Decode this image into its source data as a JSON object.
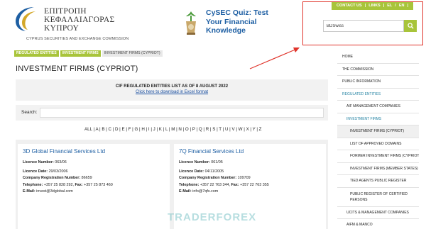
{
  "logo": {
    "lines": [
      "ΕΠΙΤΡΟΠΗ",
      "ΚΕΦΑΛΑΙΑΓΟΡΑΣ",
      "ΚΥΠΡΟΥ"
    ],
    "subtitle": "CYPRUS SECURITIES AND EXCHANGE COMMISSION"
  },
  "quiz": {
    "line1": "CySEC Quiz: Test",
    "line2": "Your Financial",
    "line3": "Knowledge"
  },
  "toplinks": [
    "CONTACT US",
    "|",
    "LINKS",
    "|",
    "EL",
    "/",
    "EN",
    "|"
  ],
  "search": {
    "value": "BDSwiss"
  },
  "breadcrumbs": [
    "REGULATED ENTITIES",
    "INVESTMENT FIRMS",
    "INVESTMENT FIRMS (CYPRIOT)"
  ],
  "page_title": "INVESTMENT FIRMS (CYPRIOT)",
  "panel": {
    "title": "CIF REGULATED ENTITIES LIST AS OF 8 AUGUST 2022",
    "link": "Click here to download in Excel format"
  },
  "search_row": {
    "label": "Search:"
  },
  "alphabet": "ALL | A | B | C | D | E | F | G | H | I | J | K | L | M | N | O | P | Q | R | S | T | U | V | W | X | Y | Z",
  "cards": [
    {
      "name": "3D Global Financial Services Ltd",
      "licence_number_label": "Licence Number:",
      "licence_number": "063/06",
      "licence_date_label": "Licence Date:",
      "licence_date": "29/03/2006",
      "reg_label": "Company Registration Number:",
      "reg": "86659",
      "tel_label": "Telephone:",
      "tel": "+357 25 828 292,",
      "fax_label": "Fax:",
      "fax": "+357 25 873 460",
      "email_label": "E-Mail:",
      "email": "invest@3dglobal.com"
    },
    {
      "name": "7Q Financial Services Ltd",
      "licence_number_label": "Licence Number:",
      "licence_number": "061/05",
      "licence_date_label": "Licence Date:",
      "licence_date": "04/11/2005",
      "reg_label": "Company Registration Number:",
      "reg": "109709",
      "tel_label": "Telephone:",
      "tel": "+357 22 763 344,",
      "fax_label": "Fax:",
      "fax": "+357 22 763 355",
      "email_label": "E-Mail:",
      "email": "info@7qfs.com"
    }
  ],
  "watermark": "TRADERFOREX",
  "sidebar": {
    "items": [
      "HOME",
      "THE COMMISSION",
      "PUBLIC INFORMATION",
      "REGULATED ENTITIES",
      "AIF MANAGEMENT COMPANIES",
      "INVESTMENT FIRMS",
      "INVESTMENT FIRMS (CYPRIOT)",
      "LIST OF APPROVED DOMAINS",
      "FORMER INVESTMENT FIRMS (CYPRIOT)",
      "INVESTMENT FIRMS (MEMBER STATES)",
      "TIED AGENTS PUBLIC REGISTER",
      "PUBLIC REGISTER OF CERTIFIED PERSONS",
      "UCITS & MANAGEMENT COMPANIES",
      "AIFM & MANCO"
    ]
  },
  "colors": {
    "accent_green": "#a8c43a",
    "link_blue": "#1e5fa3",
    "annotation_red": "#e0342b"
  },
  "icons": {
    "logo": "cysec-logo-icon",
    "quiz": "quiz-trophy-icon",
    "search": "search-icon"
  }
}
